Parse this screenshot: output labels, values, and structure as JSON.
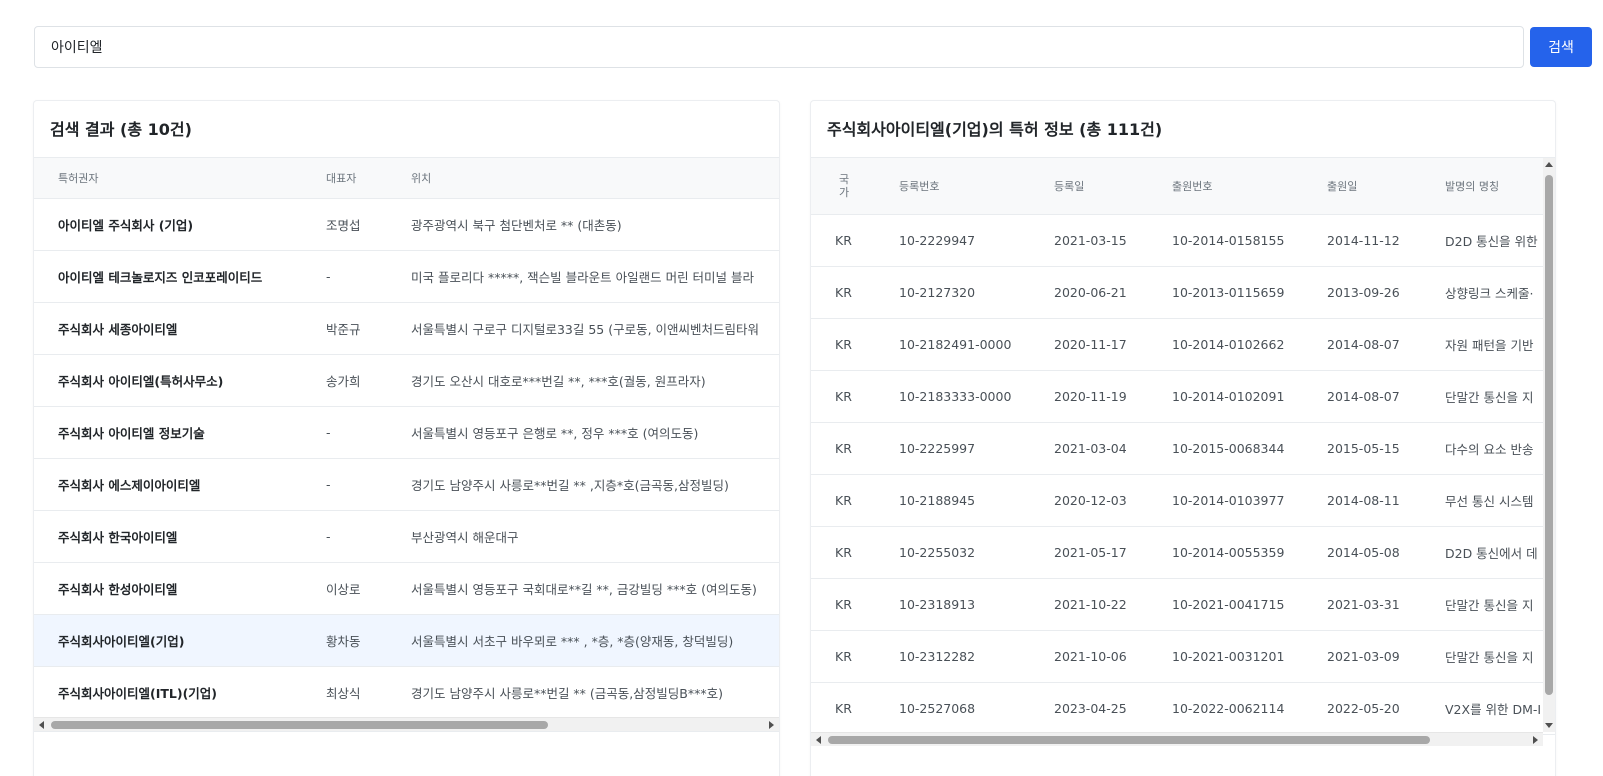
{
  "search": {
    "value": "아이티엘",
    "button_label": "검색"
  },
  "left_panel": {
    "title": "검색 결과 (총 10건)",
    "columns": [
      "특허권자",
      "대표자",
      "위치"
    ],
    "rows": [
      {
        "name": "아이티엘 주식회사 (기업)",
        "rep": "조명섭",
        "loc": "광주광역시 북구 첨단벤처로 ** (대촌동)"
      },
      {
        "name": "아이티엘 테크놀로지즈 인코포레이티드",
        "rep": "-",
        "loc": "미국 플로리다 *****, 잭슨빌 블라운트 아일랜드 머린 터미널 블라"
      },
      {
        "name": "주식회사 세종아이티엘",
        "rep": "박준규",
        "loc": "서울특별시 구로구 디지털로33길 55 (구로동, 이앤씨벤처드림타워"
      },
      {
        "name": "주식회사 아이티엘(특허사무소)",
        "rep": "송가희",
        "loc": "경기도 오산시 대호로***번길 **, ***호(궐동, 원프라자)"
      },
      {
        "name": "주식회사 아이티엘 정보기술",
        "rep": "-",
        "loc": "서울특별시 영등포구 은행로 **, 정우 ***호 (여의도동)"
      },
      {
        "name": "주식회사 에스제이아이티엘",
        "rep": "-",
        "loc": "경기도 남양주시 사릉로**번길 ** ,지층*호(금곡동,삼정빌딩)"
      },
      {
        "name": "주식회사 한국아이티엘",
        "rep": "-",
        "loc": "부산광역시 해운대구"
      },
      {
        "name": "주식회사 한성아이티엘",
        "rep": "이상로",
        "loc": "서울특별시 영등포구 국회대로**길 **, 금강빌딩 ***호 (여의도동)"
      },
      {
        "name": "주식회사아이티엘(기업)",
        "rep": "황차동",
        "loc": "서울특별시 서초구 바우뫼로 *** , *층, *층(양재동, 창덕빌딩)"
      },
      {
        "name": "주식회사아이티엘(ITL)(기업)",
        "rep": "최상식",
        "loc": "경기도 남양주시 사릉로**번길 ** (금곡동,삼정빌딩B***호)"
      }
    ]
  },
  "right_panel": {
    "title": "주식회사아이티엘(기업)의 특허 정보 (총 111건)",
    "columns": [
      "국가",
      "등록번호",
      "등록일",
      "출원번호",
      "출원일",
      "발명의 명칭"
    ],
    "rows": [
      {
        "ctry": "KR",
        "reg": "10-2229947",
        "regdate": "2021-03-15",
        "appno": "10-2014-0158155",
        "appdate": "2014-11-12",
        "title": "D2D 통신을 위한"
      },
      {
        "ctry": "KR",
        "reg": "10-2127320",
        "regdate": "2020-06-21",
        "appno": "10-2013-0115659",
        "appdate": "2013-09-26",
        "title": "상향링크 스케줄·"
      },
      {
        "ctry": "KR",
        "reg": "10-2182491-0000",
        "regdate": "2020-11-17",
        "appno": "10-2014-0102662",
        "appdate": "2014-08-07",
        "title": "자원 패턴을 기반"
      },
      {
        "ctry": "KR",
        "reg": "10-2183333-0000",
        "regdate": "2020-11-19",
        "appno": "10-2014-0102091",
        "appdate": "2014-08-07",
        "title": "단말간 통신을 지"
      },
      {
        "ctry": "KR",
        "reg": "10-2225997",
        "regdate": "2021-03-04",
        "appno": "10-2015-0068344",
        "appdate": "2015-05-15",
        "title": "다수의 요소 반송"
      },
      {
        "ctry": "KR",
        "reg": "10-2188945",
        "regdate": "2020-12-03",
        "appno": "10-2014-0103977",
        "appdate": "2014-08-11",
        "title": "무선 통신 시스템"
      },
      {
        "ctry": "KR",
        "reg": "10-2255032",
        "regdate": "2021-05-17",
        "appno": "10-2014-0055359",
        "appdate": "2014-05-08",
        "title": "D2D 통신에서 데"
      },
      {
        "ctry": "KR",
        "reg": "10-2318913",
        "regdate": "2021-10-22",
        "appno": "10-2021-0041715",
        "appdate": "2021-03-31",
        "title": "단말간 통신을 지"
      },
      {
        "ctry": "KR",
        "reg": "10-2312282",
        "regdate": "2021-10-06",
        "appno": "10-2021-0031201",
        "appdate": "2021-03-09",
        "title": "단말간 통신을 지"
      },
      {
        "ctry": "KR",
        "reg": "10-2527068",
        "regdate": "2023-04-25",
        "appno": "10-2022-0062114",
        "appdate": "2022-05-20",
        "title": "V2X를 위한 DM-I"
      }
    ]
  }
}
